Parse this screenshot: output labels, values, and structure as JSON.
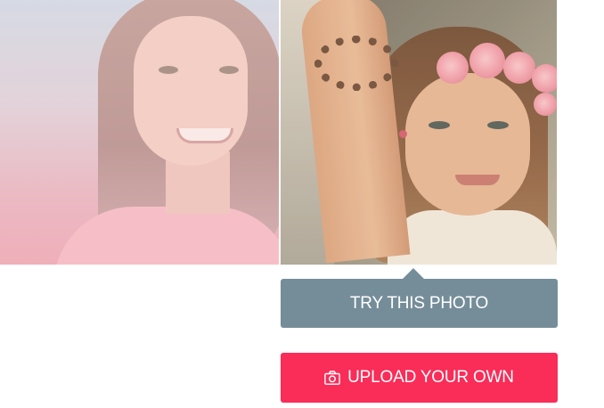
{
  "photos": [
    {
      "name": "sample-photo-left",
      "selected": false
    },
    {
      "name": "sample-photo-right",
      "selected": true
    }
  ],
  "actions": {
    "try_photo_label": "TRY THIS PHOTO",
    "upload_label": "UPLOAD YOUR OWN",
    "upload_icon": "camera-icon"
  },
  "colors": {
    "try_button": "#758d99",
    "upload_button": "#fa2c58",
    "text": "#ffffff"
  }
}
